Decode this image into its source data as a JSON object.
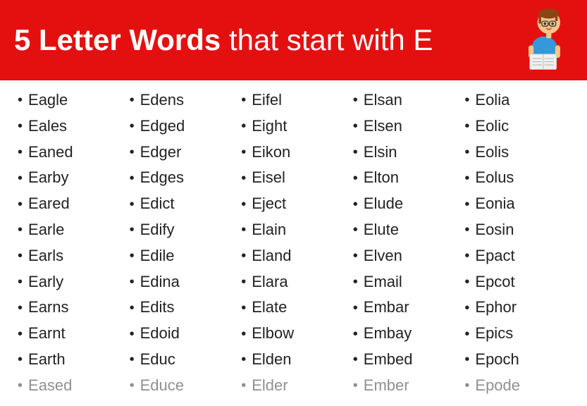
{
  "header": {
    "title_bold": "5 Letter Words",
    "title_normal": " that start with E"
  },
  "columns": [
    {
      "words": [
        "Eagle",
        "Eales",
        "Eaned",
        "Earby",
        "Eared",
        "Earle",
        "Earls",
        "Early",
        "Earns",
        "Earnt",
        "Earth",
        "Eased"
      ]
    },
    {
      "words": [
        "Edens",
        "Edged",
        "Edger",
        "Edges",
        "Edict",
        "Edify",
        "Edile",
        "Edina",
        "Edits",
        "Edoid",
        "Educ",
        "Educe"
      ]
    },
    {
      "words": [
        "Eifel",
        "Eight",
        "Eikon",
        "Eisel",
        "Eject",
        "Elain",
        "Eland",
        "Elara",
        "Elate",
        "Elbow",
        "Elden",
        "Elder"
      ]
    },
    {
      "words": [
        "Elsan",
        "Elsen",
        "Elsin",
        "Elton",
        "Elude",
        "Elute",
        "Elven",
        "Email",
        "Embar",
        "Embay",
        "Embed",
        "Ember"
      ]
    },
    {
      "words": [
        "Eolia",
        "Eolic",
        "Eolis",
        "Eolus",
        "Eonia",
        "Eosin",
        "Epact",
        "Epcot",
        "Ephor",
        "Epics",
        "Epoch",
        "Epode"
      ]
    }
  ]
}
